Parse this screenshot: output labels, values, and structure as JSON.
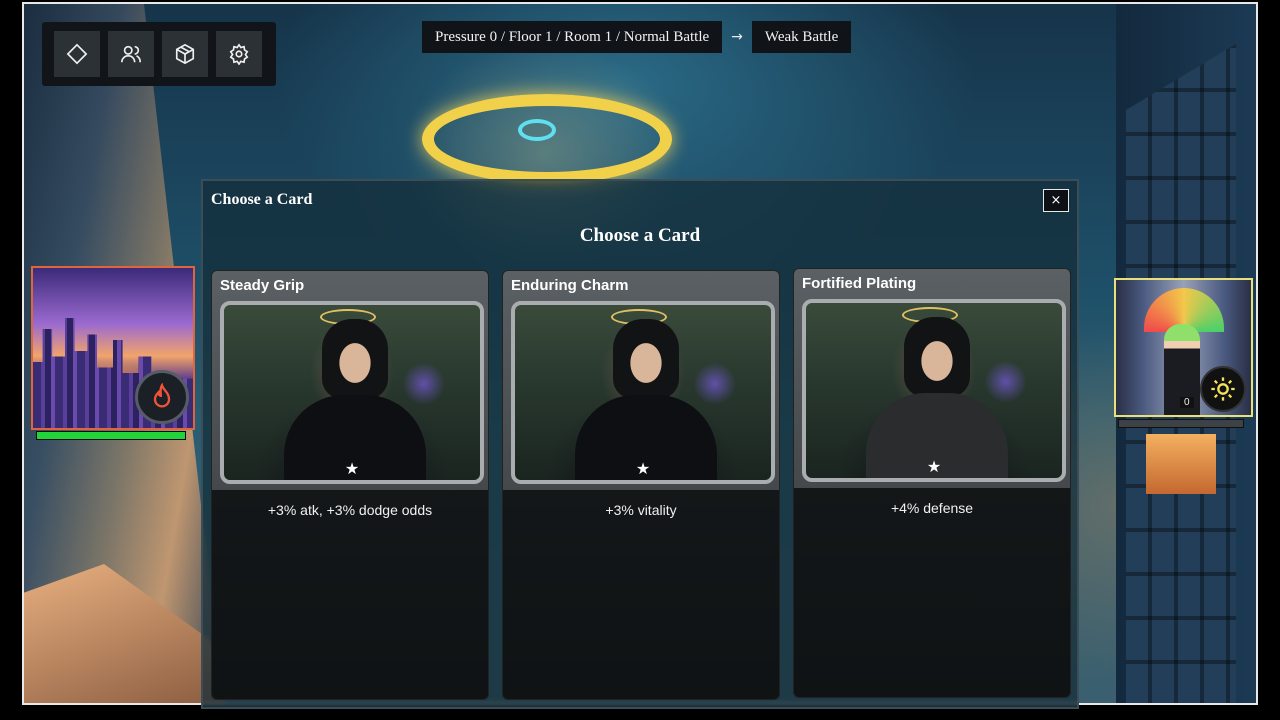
{
  "toolbar": {
    "buttons": [
      {
        "name": "map",
        "icon": "diamond-icon"
      },
      {
        "name": "party",
        "icon": "users-icon"
      },
      {
        "name": "inventory",
        "icon": "cube-icon"
      },
      {
        "name": "settings",
        "icon": "gear-icon"
      }
    ]
  },
  "breadcrumb": {
    "location": "Pressure 0 / Floor 1 / Room 1 / Normal Battle",
    "arrow": "→",
    "next": "Weak Battle"
  },
  "party": {
    "left": {
      "element": "fire-icon",
      "hp_fraction": 1.0,
      "accent": "#e0653a"
    },
    "right": {
      "element": "sun-icon",
      "level": "0",
      "hp_fraction": 0.0,
      "accent": "#e8e07a"
    }
  },
  "modal": {
    "title": "Choose a Card",
    "heading": "Choose a Card",
    "close": "×",
    "cards": [
      {
        "name": "Steady Grip",
        "stars": "★",
        "description": "+3% atk, +3% dodge odds"
      },
      {
        "name": "Enduring Charm",
        "stars": "★",
        "description": "+3% vitality"
      },
      {
        "name": "Fortified Plating",
        "stars": "★",
        "description": "+4% defense"
      }
    ]
  },
  "colors": {
    "hp": "#22d43a",
    "halo": "#f2d14a"
  }
}
